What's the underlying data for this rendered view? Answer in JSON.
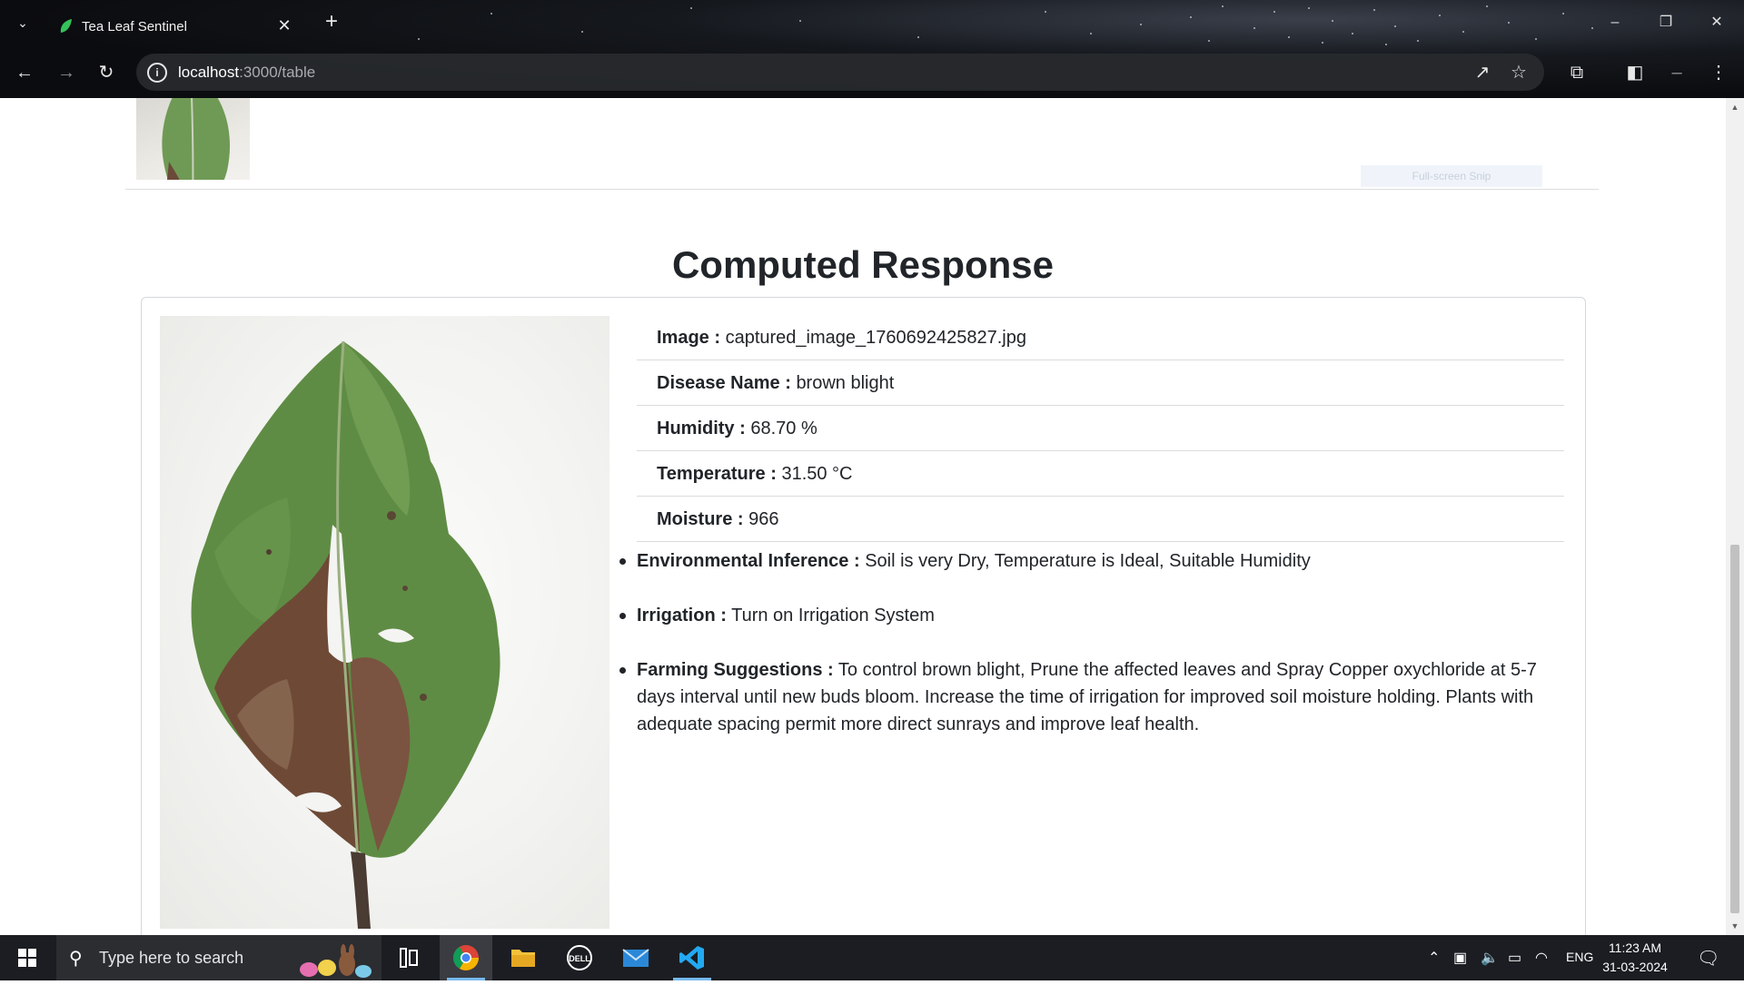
{
  "browser": {
    "tab_title": "Tea Leaf Sentinel",
    "url_host": "localhost",
    "url_rest": ":3000/table"
  },
  "page": {
    "snip_hint": "Full-screen Snip",
    "section_title": "Computed Response",
    "details": [
      {
        "label": "Image :",
        "value": "captured_image_1760692425827.jpg"
      },
      {
        "label": "Disease Name :",
        "value": "brown blight"
      },
      {
        "label": "Humidity :",
        "value": "68.70 %"
      },
      {
        "label": "Temperature :",
        "value": "31.50 °C"
      },
      {
        "label": "Moisture :",
        "value": "966"
      }
    ],
    "advice": [
      {
        "label": "Environmental Inference :",
        "value": "Soil is very Dry, Temperature is Ideal, Suitable Humidity"
      },
      {
        "label": "Irrigation :",
        "value": "Turn on Irrigation System"
      },
      {
        "label": "Farming Suggestions :",
        "value": "To control brown blight, Prune the affected leaves and Spray Copper oxychloride at 5-7 days interval until new buds bloom. Increase the time of irrigation for improved soil moisture holding. Plants with adequate spacing permit more direct sunrays and improve leaf health."
      }
    ]
  },
  "taskbar": {
    "search_placeholder": "Type here to search",
    "language": "ENG",
    "time": "11:23 AM",
    "date": "31-03-2024"
  },
  "colors": {
    "text": "#212529",
    "border": "#d9dbdd",
    "taskbar": "#1b1d22",
    "leaf_green": "#5f8c44",
    "leaf_brown": "#6e4a36"
  },
  "icons": [
    "tab-list-icon",
    "leaf-favicon-icon",
    "close-icon",
    "plus-icon",
    "minimize-icon",
    "restore-icon",
    "back-icon",
    "forward-icon",
    "reload-icon",
    "info-icon",
    "open-in-app-icon",
    "star-icon",
    "extensions-icon",
    "side-panel-icon",
    "menu-icon",
    "windows-icon",
    "search-icon",
    "task-view-icon",
    "chrome-icon",
    "file-explorer-icon",
    "dell-icon",
    "mail-icon",
    "vscode-icon",
    "chevron-up-icon",
    "battery-icon",
    "wifi-icon",
    "volume-icon",
    "notification-icon"
  ]
}
